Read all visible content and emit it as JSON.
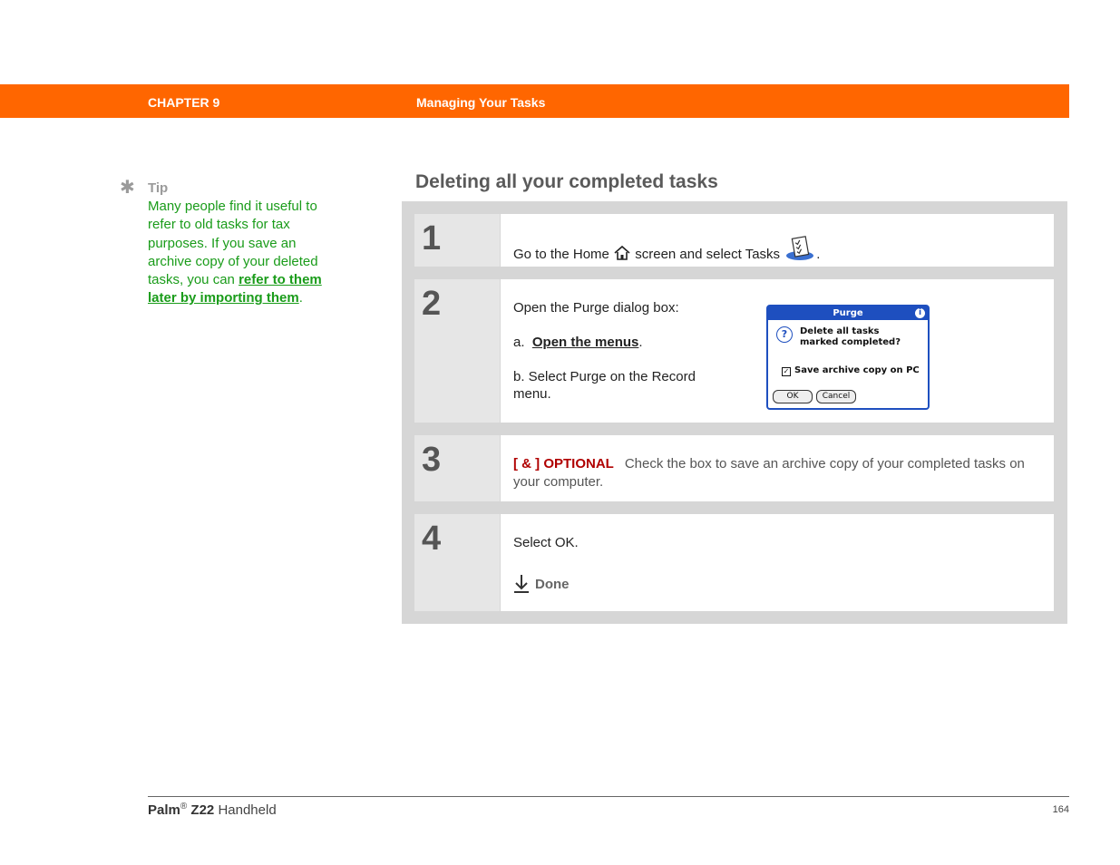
{
  "header": {
    "chapter": "CHAPTER 9",
    "title": "Managing Your Tasks"
  },
  "tip": {
    "label": "Tip",
    "text_before": "Many people find it useful to refer to old tasks for tax purposes. If you save an archive copy of your deleted tasks, you can ",
    "link": "refer to them later by importing them",
    "text_after": "."
  },
  "section": {
    "title": "Deleting all your completed tasks"
  },
  "steps": [
    {
      "number": "1",
      "text_a": "Go to the Home",
      "text_b": "screen and select Tasks",
      "text_c": "."
    },
    {
      "number": "2",
      "intro": "Open the Purge dialog box:",
      "a_prefix": "a.",
      "a_link": "Open the menus",
      "a_suffix": ".",
      "b": "b.  Select Purge on the Record menu.",
      "dialog": {
        "title": "Purge",
        "info_glyph": "i",
        "question_glyph": "?",
        "message_line1": "Delete all tasks",
        "message_line2": "marked completed?",
        "checkbox_label": "Save archive copy on PC",
        "checkbox_checked": true,
        "ok": "OK",
        "cancel": "Cancel"
      }
    },
    {
      "number": "3",
      "tag": "[ & ]  OPTIONAL",
      "text": "Check the box to save an archive copy of your completed tasks on your computer."
    },
    {
      "number": "4",
      "text": "Select OK.",
      "done": "Done"
    }
  ],
  "footer": {
    "brand": "Palm",
    "reg": "®",
    "model": "Z22",
    "product": "Handheld",
    "page": "164"
  },
  "colors": {
    "header_bg": "#ff6600",
    "tip_green": "#1a9c1a",
    "optional_red": "#b00000",
    "dialog_blue": "#1e4fbf"
  },
  "icons": [
    "tip-star-icon",
    "home-icon",
    "tasks-icon",
    "done-arrow-icon"
  ]
}
